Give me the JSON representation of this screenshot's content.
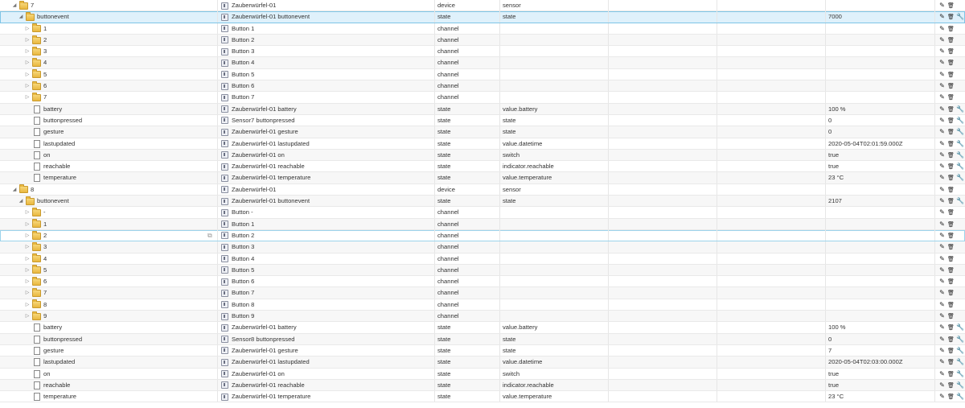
{
  "rows": [
    {
      "level": 0,
      "node": "folder",
      "toggle": "◢",
      "id": "7",
      "name": "Zauberwürfel-01",
      "type": "device",
      "role": "sensor",
      "value": "",
      "actions": [
        "pencil-icon",
        "trash-icon"
      ]
    },
    {
      "level": 1,
      "node": "folder",
      "toggle": "◢",
      "id": "buttonevent",
      "name": "Zauberwürfel-01 buttonevent",
      "type": "state",
      "role": "state",
      "value": "7000",
      "actions": [
        "pencil-icon",
        "trash-icon",
        "wrench-icon"
      ],
      "selected": true
    },
    {
      "level": 2,
      "node": "folder",
      "toggle": "▷",
      "id": "1",
      "name": "Button 1",
      "type": "channel",
      "role": "",
      "value": "",
      "actions": [
        "pencil-icon",
        "trash-icon"
      ]
    },
    {
      "level": 2,
      "node": "folder",
      "toggle": "▷",
      "id": "2",
      "name": "Button 2",
      "type": "channel",
      "role": "",
      "value": "",
      "actions": [
        "pencil-icon",
        "trash-icon"
      ]
    },
    {
      "level": 2,
      "node": "folder",
      "toggle": "▷",
      "id": "3",
      "name": "Button 3",
      "type": "channel",
      "role": "",
      "value": "",
      "actions": [
        "pencil-icon",
        "trash-icon"
      ]
    },
    {
      "level": 2,
      "node": "folder",
      "toggle": "▷",
      "id": "4",
      "name": "Button 4",
      "type": "channel",
      "role": "",
      "value": "",
      "actions": [
        "pencil-icon",
        "trash-icon"
      ]
    },
    {
      "level": 2,
      "node": "folder",
      "toggle": "▷",
      "id": "5",
      "name": "Button 5",
      "type": "channel",
      "role": "",
      "value": "",
      "actions": [
        "pencil-icon",
        "trash-icon"
      ]
    },
    {
      "level": 2,
      "node": "folder",
      "toggle": "▷",
      "id": "6",
      "name": "Button 6",
      "type": "channel",
      "role": "",
      "value": "",
      "actions": [
        "pencil-icon",
        "trash-icon"
      ]
    },
    {
      "level": 2,
      "node": "folder",
      "toggle": "▷",
      "id": "7",
      "name": "Button 7",
      "type": "channel",
      "role": "",
      "value": "",
      "actions": [
        "pencil-icon",
        "trash-icon"
      ]
    },
    {
      "level": 2,
      "node": "file",
      "toggle": "",
      "id": "battery",
      "name": "Zauberwürfel-01 battery",
      "type": "state",
      "role": "value.battery",
      "value": "100 %",
      "actions": [
        "pencil-icon",
        "trash-icon",
        "wrench-icon"
      ]
    },
    {
      "level": 2,
      "node": "file",
      "toggle": "",
      "id": "buttonpressed",
      "name": "Sensor7 buttonpressed",
      "type": "state",
      "role": "state",
      "value": "0",
      "actions": [
        "pencil-icon",
        "trash-icon",
        "wrench-icon"
      ]
    },
    {
      "level": 2,
      "node": "file",
      "toggle": "",
      "id": "gesture",
      "name": "Zauberwürfel-01 gesture",
      "type": "state",
      "role": "state",
      "value": "0",
      "actions": [
        "pencil-icon",
        "trash-icon",
        "wrench-icon"
      ]
    },
    {
      "level": 2,
      "node": "file",
      "toggle": "",
      "id": "lastupdated",
      "name": "Zauberwürfel-01 lastupdated",
      "type": "state",
      "role": "value.datetime",
      "value": "2020-05-04T02:01:59.000Z",
      "actions": [
        "pencil-icon",
        "trash-icon",
        "wrench-icon"
      ]
    },
    {
      "level": 2,
      "node": "file",
      "toggle": "",
      "id": "on",
      "name": "Zauberwürfel-01 on",
      "type": "state",
      "role": "switch",
      "value": "true",
      "actions": [
        "pencil-icon",
        "trash-icon",
        "wrench-icon"
      ]
    },
    {
      "level": 2,
      "node": "file",
      "toggle": "",
      "id": "reachable",
      "name": "Zauberwürfel-01 reachable",
      "type": "state",
      "role": "indicator.reachable",
      "value": "true",
      "actions": [
        "pencil-icon",
        "trash-icon",
        "wrench-icon"
      ]
    },
    {
      "level": 2,
      "node": "file",
      "toggle": "",
      "id": "temperature",
      "name": "Zauberwürfel-01 temperature",
      "type": "state",
      "role": "value.temperature",
      "value": "23 °C",
      "actions": [
        "pencil-icon",
        "trash-icon",
        "wrench-icon"
      ]
    },
    {
      "level": 0,
      "node": "folder",
      "toggle": "◢",
      "id": "8",
      "name": "Zauberwürfel-01",
      "type": "device",
      "role": "sensor",
      "value": "",
      "actions": [
        "pencil-icon",
        "trash-icon"
      ]
    },
    {
      "level": 1,
      "node": "folder",
      "toggle": "◢",
      "id": "buttonevent",
      "name": "Zauberwürfel-01 buttonevent",
      "type": "state",
      "role": "state",
      "value": "2107",
      "actions": [
        "pencil-icon",
        "trash-icon",
        "wrench-icon"
      ]
    },
    {
      "level": 2,
      "node": "folder",
      "toggle": "▷",
      "id": "-",
      "name": "Button -",
      "type": "channel",
      "role": "",
      "value": "",
      "actions": [
        "pencil-icon",
        "trash-icon"
      ]
    },
    {
      "level": 2,
      "node": "folder",
      "toggle": "▷",
      "id": "1",
      "name": "Button 1",
      "type": "channel",
      "role": "",
      "value": "",
      "actions": [
        "pencil-icon",
        "trash-icon"
      ]
    },
    {
      "level": 2,
      "node": "folder",
      "toggle": "▷",
      "id": "2",
      "name": "Button 2",
      "type": "channel",
      "role": "",
      "value": "",
      "actions": [
        "pencil-icon",
        "trash-icon"
      ],
      "hover": true
    },
    {
      "level": 2,
      "node": "folder",
      "toggle": "▷",
      "id": "3",
      "name": "Button 3",
      "type": "channel",
      "role": "",
      "value": "",
      "actions": [
        "pencil-icon",
        "trash-icon"
      ]
    },
    {
      "level": 2,
      "node": "folder",
      "toggle": "▷",
      "id": "4",
      "name": "Button 4",
      "type": "channel",
      "role": "",
      "value": "",
      "actions": [
        "pencil-icon",
        "trash-icon"
      ]
    },
    {
      "level": 2,
      "node": "folder",
      "toggle": "▷",
      "id": "5",
      "name": "Button 5",
      "type": "channel",
      "role": "",
      "value": "",
      "actions": [
        "pencil-icon",
        "trash-icon"
      ]
    },
    {
      "level": 2,
      "node": "folder",
      "toggle": "▷",
      "id": "6",
      "name": "Button 6",
      "type": "channel",
      "role": "",
      "value": "",
      "actions": [
        "pencil-icon",
        "trash-icon"
      ]
    },
    {
      "level": 2,
      "node": "folder",
      "toggle": "▷",
      "id": "7",
      "name": "Button 7",
      "type": "channel",
      "role": "",
      "value": "",
      "actions": [
        "pencil-icon",
        "trash-icon"
      ]
    },
    {
      "level": 2,
      "node": "folder",
      "toggle": "▷",
      "id": "8",
      "name": "Button 8",
      "type": "channel",
      "role": "",
      "value": "",
      "actions": [
        "pencil-icon",
        "trash-icon"
      ]
    },
    {
      "level": 2,
      "node": "folder",
      "toggle": "▷",
      "id": "9",
      "name": "Button 9",
      "type": "channel",
      "role": "",
      "value": "",
      "actions": [
        "pencil-icon",
        "trash-icon"
      ]
    },
    {
      "level": 2,
      "node": "file",
      "toggle": "",
      "id": "battery",
      "name": "Zauberwürfel-01 battery",
      "type": "state",
      "role": "value.battery",
      "value": "100 %",
      "actions": [
        "pencil-icon",
        "trash-icon",
        "wrench-icon"
      ]
    },
    {
      "level": 2,
      "node": "file",
      "toggle": "",
      "id": "buttonpressed",
      "name": "Sensor8 buttonpressed",
      "type": "state",
      "role": "state",
      "value": "0",
      "actions": [
        "pencil-icon",
        "trash-icon",
        "wrench-icon"
      ]
    },
    {
      "level": 2,
      "node": "file",
      "toggle": "",
      "id": "gesture",
      "name": "Zauberwürfel-01 gesture",
      "type": "state",
      "role": "state",
      "value": "7",
      "actions": [
        "pencil-icon",
        "trash-icon",
        "wrench-icon"
      ]
    },
    {
      "level": 2,
      "node": "file",
      "toggle": "",
      "id": "lastupdated",
      "name": "Zauberwürfel-01 lastupdated",
      "type": "state",
      "role": "value.datetime",
      "value": "2020-05-04T02:03:00.000Z",
      "actions": [
        "pencil-icon",
        "trash-icon",
        "wrench-icon"
      ]
    },
    {
      "level": 2,
      "node": "file",
      "toggle": "",
      "id": "on",
      "name": "Zauberwürfel-01 on",
      "type": "state",
      "role": "switch",
      "value": "true",
      "actions": [
        "pencil-icon",
        "trash-icon",
        "wrench-icon"
      ]
    },
    {
      "level": 2,
      "node": "file",
      "toggle": "",
      "id": "reachable",
      "name": "Zauberwürfel-01 reachable",
      "type": "state",
      "role": "indicator.reachable",
      "value": "true",
      "actions": [
        "pencil-icon",
        "trash-icon",
        "wrench-icon"
      ]
    },
    {
      "level": 2,
      "node": "file",
      "toggle": "",
      "id": "temperature",
      "name": "Zauberwürfel-01 temperature",
      "type": "state",
      "role": "value.temperature",
      "value": "23 °C",
      "actions": [
        "pencil-icon",
        "trash-icon",
        "wrench-icon"
      ]
    }
  ]
}
